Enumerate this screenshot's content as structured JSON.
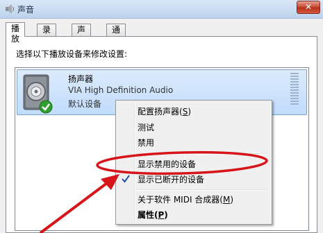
{
  "window": {
    "title": "声音"
  },
  "tabs": [
    {
      "label": "播放",
      "active": true
    },
    {
      "label": "录制",
      "active": false
    },
    {
      "label": "声音",
      "active": false
    },
    {
      "label": "通信",
      "active": false
    }
  ],
  "panel": {
    "instruction": "选择以下播放设备来修改设置:"
  },
  "device": {
    "name": "扬声器",
    "driver": "VIA High Definition Audio",
    "status": "默认设备",
    "icon": "speaker-icon",
    "badge_icon": "green-check-icon"
  },
  "context_menu": {
    "items": [
      {
        "label": "配置扬声器(",
        "key": "S",
        "suffix": ")"
      },
      {
        "label": "测试"
      },
      {
        "label": "禁用"
      },
      {
        "label": "显示禁用的设备",
        "highlighted_by_annotation": true
      },
      {
        "label": "显示已断开的设备",
        "checked": true
      },
      {
        "label": "关于软件 MIDI 合成器(",
        "key": "M",
        "suffix": ")"
      },
      {
        "label": "属性(",
        "key": "P",
        "suffix": ")",
        "bold": true
      }
    ]
  },
  "colors": {
    "annotation": "#d8141b",
    "selection": "#c1dcfc",
    "checkmark": "#1c4fa0"
  }
}
